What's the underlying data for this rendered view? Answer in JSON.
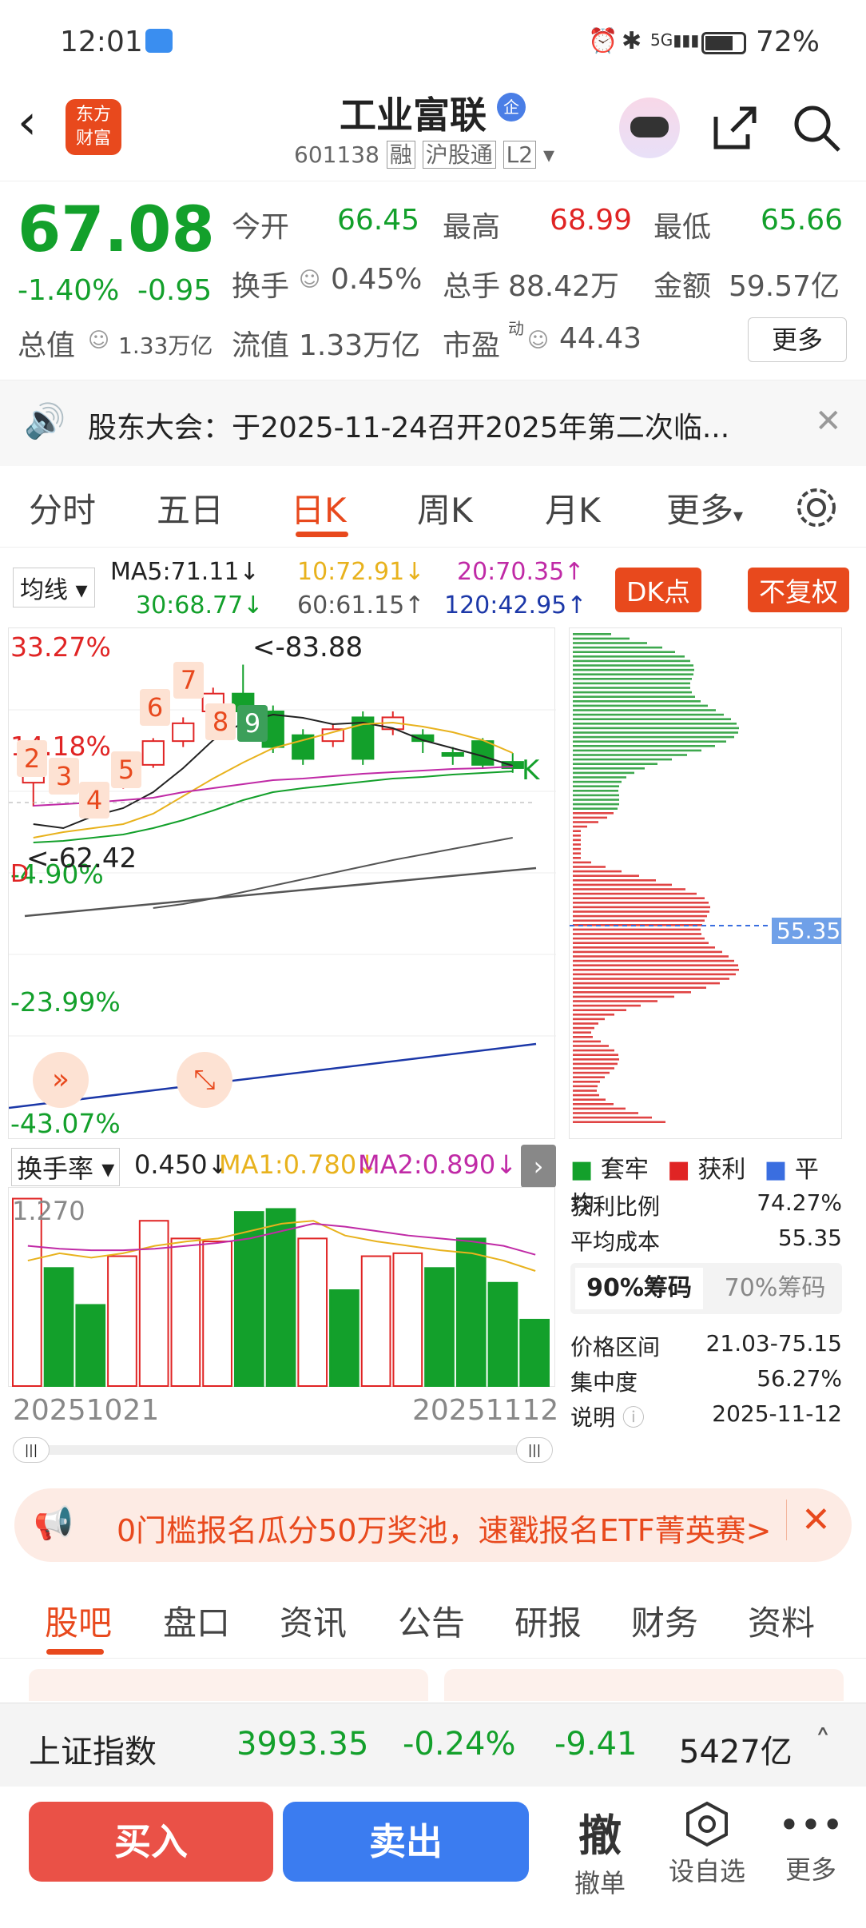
{
  "status": {
    "time": "12:01",
    "battery": "72%",
    "signal": "5G"
  },
  "header": {
    "title": "工业富联",
    "badge": "企",
    "code": "601138",
    "tags": [
      "融",
      "沪股通",
      "L2"
    ],
    "logo_top": "东方",
    "logo_bottom": "财富"
  },
  "quote": {
    "price": "67.08",
    "pct": "-1.40%",
    "chg": "-0.95",
    "open_label": "今开",
    "open": "66.45",
    "high_label": "最高",
    "high": "68.99",
    "low_label": "最低",
    "low": "65.66",
    "turnover_label": "换手",
    "turnover": "0.45%",
    "vol_label": "总手",
    "vol": "88.42万",
    "amt_label": "金额",
    "amt": "59.57亿",
    "mcap_label": "总值",
    "mcap": "1.33万亿",
    "float_label": "流值",
    "float": "1.33万亿",
    "pe_label": "市盈",
    "pe_sup": "动",
    "pe": "44.43",
    "more": "更多"
  },
  "announce": {
    "text": "股东大会：于2025-11-24召开2025年第二次临..."
  },
  "tabs": [
    "分时",
    "五日",
    "日K",
    "周K",
    "月K",
    "更多"
  ],
  "active_tab": "日K",
  "ma": {
    "selector": "均线",
    "ma5": "MA5:71.11↓",
    "ma10": "10:72.91↓",
    "ma20": "20:70.35↑",
    "ma30": "30:68.77↓",
    "ma60": "60:61.15↑",
    "ma120": "120:42.95↑",
    "dk": "DK点",
    "fq": "不复权"
  },
  "chart": {
    "p1": "33.27%",
    "p2": "14.18%",
    "p3": "-4.90%",
    "p4": "-23.99%",
    "p5": "-43.07%",
    "hi_label": "<-83.88",
    "lo_label": "<-62.42",
    "nums": [
      "2",
      "3",
      "4",
      "5",
      "6",
      "7",
      "8",
      "9"
    ],
    "k_mark": "K",
    "d_mark": "D"
  },
  "chart_data": {
    "type": "candlestick",
    "candles": [
      [
        64,
        66,
        60,
        66.5
      ],
      [
        65,
        64,
        62,
        66
      ],
      [
        63,
        62.5,
        61,
        64
      ],
      [
        64,
        66,
        63,
        66.5
      ],
      [
        67,
        71,
        66.5,
        71.5
      ],
      [
        71,
        74,
        70,
        75
      ],
      [
        76,
        79,
        75,
        80
      ],
      [
        79,
        76,
        75,
        83.88
      ],
      [
        76,
        70,
        69,
        77
      ],
      [
        72,
        68,
        67,
        73
      ],
      [
        71,
        73,
        70,
        74
      ],
      [
        75,
        68,
        67,
        76
      ],
      [
        73,
        75,
        72,
        76
      ],
      [
        72,
        71,
        69,
        73
      ],
      [
        69,
        68.5,
        67,
        70
      ],
      [
        71,
        67,
        66.5,
        71.5
      ],
      [
        67.5,
        66.45,
        65.66,
        68.99
      ]
    ]
  },
  "dist": {
    "price_label": "55.35"
  },
  "vol": {
    "selector": "换手率",
    "val": "0.450↓",
    "ma1": "MA1:0.780↓",
    "ma2": "MA2:0.890↓",
    "top": "1.270",
    "d1": "20251021",
    "d2": "20251112",
    "bars": [
      1.27,
      0.8,
      0.55,
      0.88,
      1.12,
      1.0,
      0.98,
      1.18,
      1.2,
      1.0,
      0.65,
      0.88,
      0.9,
      0.8,
      1.0,
      0.7,
      0.45
    ],
    "up": [
      1,
      0,
      0,
      1,
      1,
      1,
      1,
      0,
      0,
      1,
      0,
      1,
      1,
      0,
      0,
      0,
      0
    ]
  },
  "legend": {
    "a": "套牢",
    "b": "获利",
    "c": "平均"
  },
  "info": {
    "profit_label": "获利比例",
    "profit": "74.27%",
    "cost_label": "平均成本",
    "cost": "55.35",
    "tab90": "90%筹码",
    "tab70": "70%筹码",
    "range_label": "价格区间",
    "range": "21.03-75.15",
    "conc_label": "集中度",
    "conc": "56.27%",
    "note_label": "说明",
    "note": "2025-11-12"
  },
  "banner": {
    "text": "0门槛报名瓜分50万奖池，速戳报名ETF菁英赛>"
  },
  "subtabs": [
    "股吧",
    "盘口",
    "资讯",
    "公告",
    "研报",
    "财务",
    "资料"
  ],
  "index": {
    "name": "上证指数",
    "value": "3993.35",
    "pct": "-0.24%",
    "chg": "-9.41",
    "amt": "5427亿"
  },
  "bottom": {
    "buy": "买入",
    "sell": "卖出",
    "cancel_icon": "撤",
    "cancel": "撤单",
    "watch": "设自选",
    "more": "更多"
  }
}
